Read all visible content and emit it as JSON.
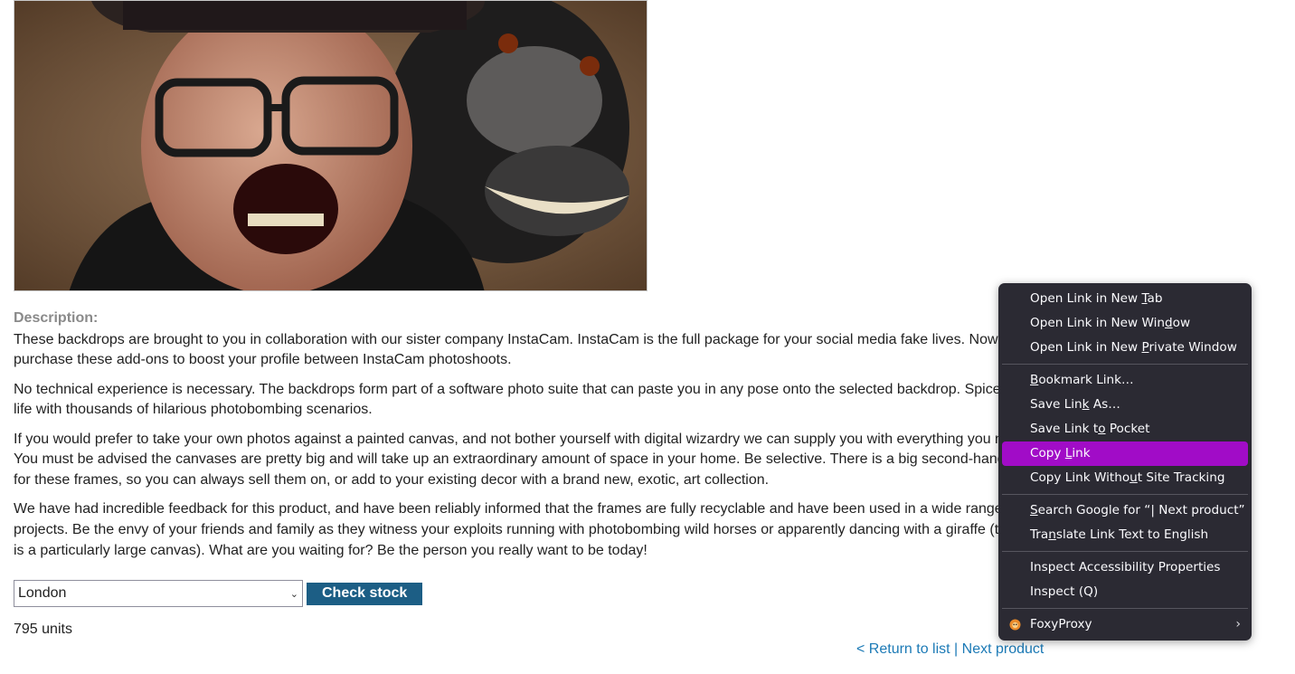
{
  "product": {
    "image_alt": "Man in hat with monkey photobomb backdrop",
    "description_heading": "Description:",
    "paragraphs": [
      "These backdrops are brought to you in collaboration with our sister company InstaCam. InstaCam is the full package for your social media fake lives. Now you can purchase these add-ons to boost your profile between InstaCam photoshoots.",
      "No technical experience is necessary. The backdrops form part of a software photo suite that can paste you in any pose onto the selected backdrop. Spice up your life with thousands of hilarious photobombing scenarios.",
      "If you would prefer to take your own photos against a painted canvas, and not bother yourself with digital wizardry we can supply you with everything you need. You must be advised the canvases are pretty big and will take up an extraordinary amount of space in your home. Be selective. There is a big second-hand market for these frames, so you can always sell them on, or add to your existing decor with a brand new, exotic, art collection.",
      "We have had incredible feedback for this product, and have been reliably informed that the frames are fully recyclable and have been used in a wide range of DIY projects. Be the envy of your friends and family as they witness your exploits running with photobombing wild horses or apparently dancing with a giraffe (this one is a particularly large canvas). What are you waiting for? Be the person you really want to be today!"
    ]
  },
  "stock": {
    "selected_store": "London",
    "check_label": "Check stock",
    "result": "795 units"
  },
  "nav": {
    "return_label": "< Return to list",
    "separator": " | ",
    "next_label": "Next product"
  },
  "context_menu": {
    "open_new_tab": [
      "Open Link in New ",
      "T",
      "ab"
    ],
    "open_new_window": [
      "Open Link in New Win",
      "d",
      "ow"
    ],
    "open_private": [
      "Open Link in New ",
      "P",
      "rivate Window"
    ],
    "bookmark": [
      "",
      "B",
      "ookmark Link…"
    ],
    "save_link": [
      "Save Lin",
      "k",
      " As…"
    ],
    "save_pocket": [
      "Save Link t",
      "o",
      " Pocket"
    ],
    "copy_link": [
      "Copy ",
      "L",
      "ink"
    ],
    "copy_no_tracking": [
      "Copy Link Witho",
      "u",
      "t Site Tracking"
    ],
    "search_google": [
      "",
      "S",
      "earch Google for “| Next product”"
    ],
    "translate": [
      "Tra",
      "n",
      "slate Link Text to English"
    ],
    "inspect_a11y": "Inspect Accessibility Properties",
    "inspect": "Inspect (Q)",
    "foxyproxy": "FoxyProxy"
  }
}
